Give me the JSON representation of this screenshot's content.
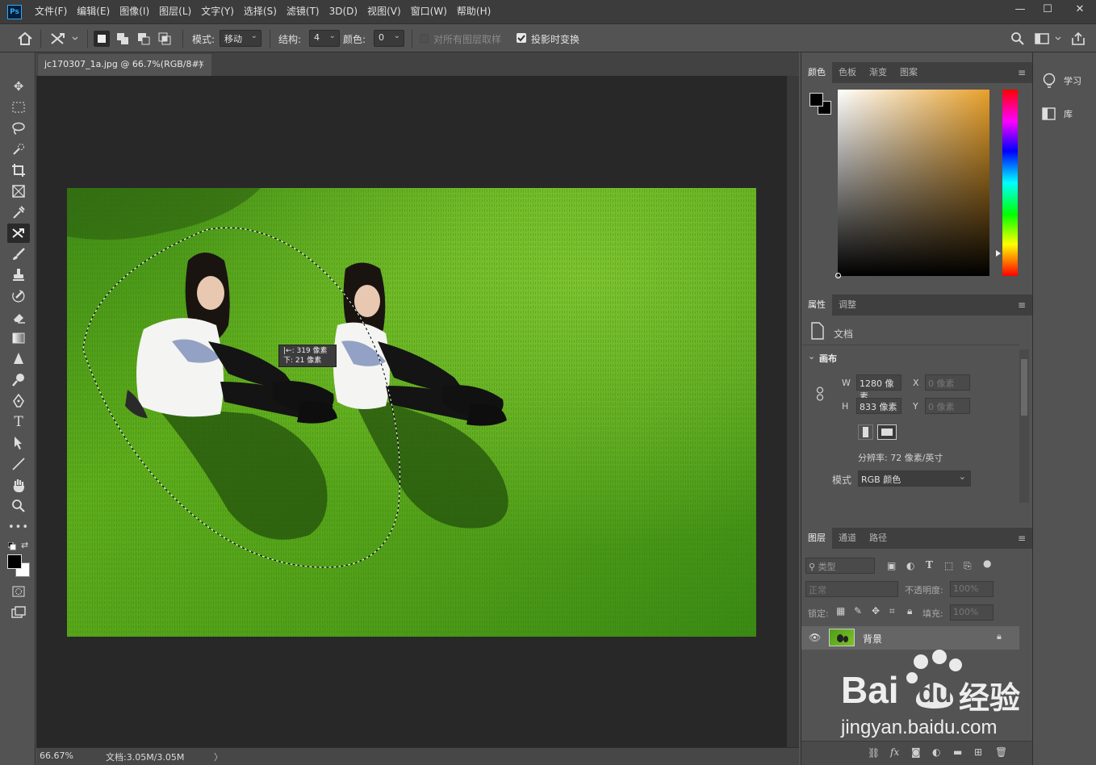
{
  "app": {
    "logo": "Ps"
  },
  "menu": [
    "文件(F)",
    "编辑(E)",
    "图像(I)",
    "图层(L)",
    "文字(Y)",
    "选择(S)",
    "滤镜(T)",
    "3D(D)",
    "视图(V)",
    "窗口(W)",
    "帮助(H)"
  ],
  "window_controls": {
    "minimize": "—",
    "restore": "☐",
    "close": "✕"
  },
  "options": {
    "mode_label": "模式:",
    "mode_value": "移动",
    "structure_label": "结构:",
    "structure_value": "4",
    "color_label": "颜色:",
    "color_value": "0",
    "sample_all_layers": "对所有图层取样",
    "transform_on_drop": "投影时变换"
  },
  "document": {
    "tab_title": "jc170307_1a.jpg @ 66.7%(RGB/8#)",
    "tab_close": "×",
    "tooltip_line1": "|←: 319 像素",
    "tooltip_line2": "下:  21 像素"
  },
  "status": {
    "zoom": "66.67%",
    "doc_size": "文档:3.05M/3.05M",
    "arrow": "〉"
  },
  "color_panel": {
    "tabs": [
      "颜色",
      "色板",
      "渐变",
      "图案"
    ],
    "active": 0
  },
  "properties_panel": {
    "tabs": [
      "属性",
      "调整"
    ],
    "doc_label": "文档",
    "canvas_section": "画布",
    "w_label": "W",
    "w_value": "1280 像素",
    "h_label": "H",
    "h_value": "833 像素",
    "x_label": "X",
    "x_placeholder": "0 像素",
    "y_label": "Y",
    "y_placeholder": "0 像素",
    "resolution": "分辨率: 72 像素/英寸",
    "mode_label": "模式",
    "mode_value": "RGB 颜色"
  },
  "layers_panel": {
    "tabs": [
      "图层",
      "通道",
      "路径"
    ],
    "filter_placeholder": "类型",
    "blend_mode": "正常",
    "opacity_label": "不透明度:",
    "opacity_value": "100%",
    "lock_label": "锁定:",
    "fill_label": "填充:",
    "fill_value": "100%",
    "layer_name": "背景"
  },
  "far_right": {
    "learn": "学习",
    "library": "库"
  },
  "watermark": {
    "brand": "Bai",
    "brand2": "du",
    "product": "经验",
    "url": "jingyan.baidu.com"
  },
  "colors": {
    "foreground": "#000000",
    "background": "#ffffff",
    "accent": "#e8a02a"
  }
}
